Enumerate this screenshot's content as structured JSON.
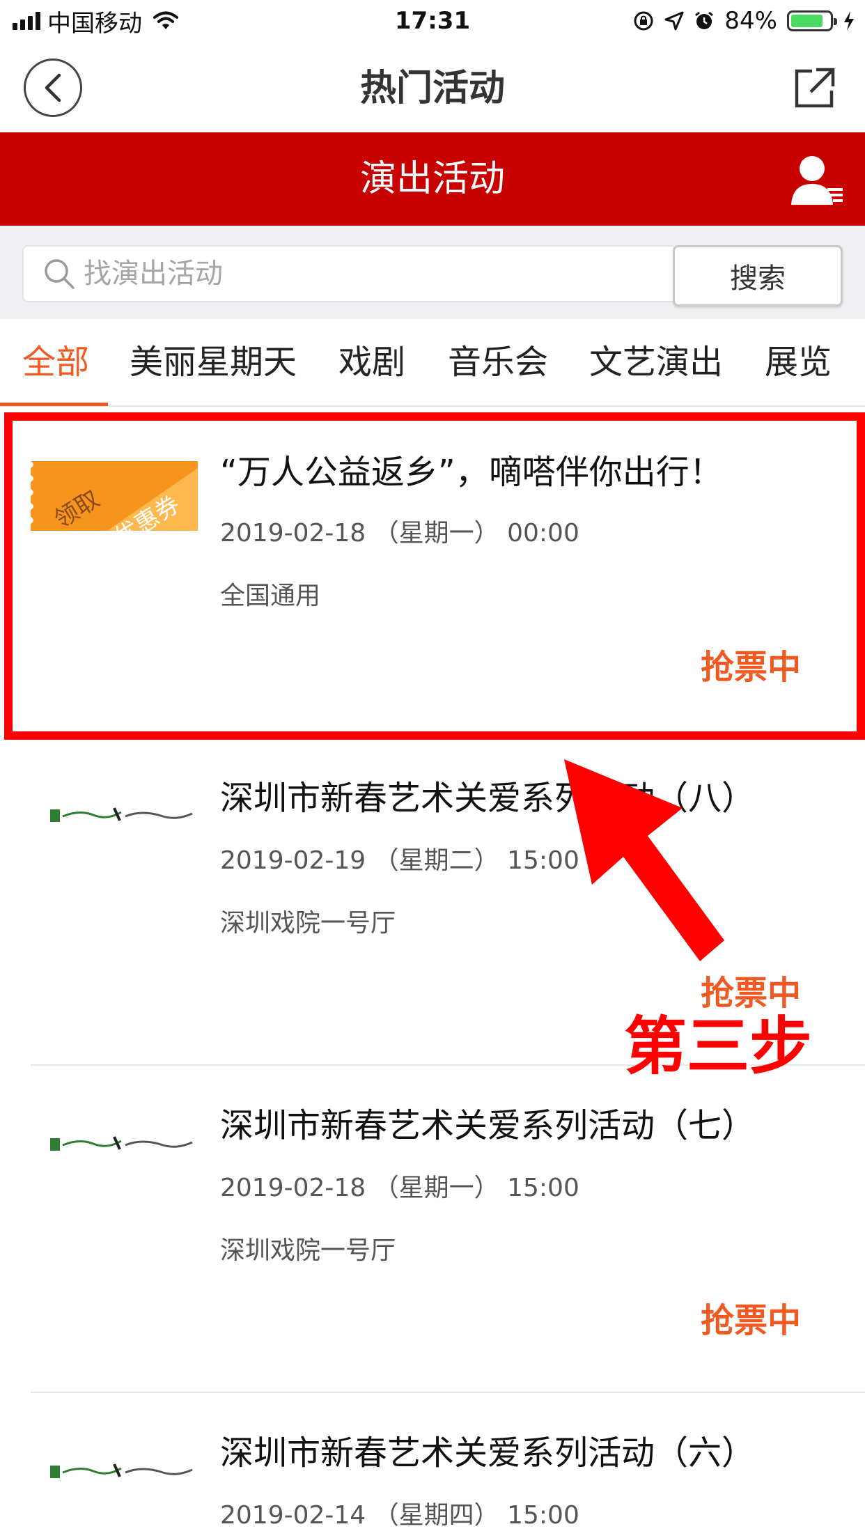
{
  "status_bar": {
    "carrier": "中国移动",
    "time": "17:31",
    "battery": "84%",
    "battery_level": 0.84
  },
  "nav": {
    "title": "热门活动",
    "back_icon": "chevron-left-icon",
    "share_icon": "share-icon"
  },
  "header": {
    "title": "演出活动",
    "user_icon": "user-icon"
  },
  "search": {
    "placeholder": "找演出活动",
    "button_label": "搜索"
  },
  "tabs": [
    {
      "label": "全部",
      "active": true
    },
    {
      "label": "美丽星期天",
      "active": false
    },
    {
      "label": "戏剧",
      "active": false
    },
    {
      "label": "音乐会",
      "active": false
    },
    {
      "label": "文艺演出",
      "active": false
    },
    {
      "label": "展览",
      "active": false
    }
  ],
  "events": [
    {
      "title": "“万人公益返乡”，嘀嗒伴你出行！",
      "date": "2019-02-18 （星期一） 00:00",
      "venue": "全国通用",
      "status": "抢票中",
      "thumb_text": [
        "领取",
        "优惠券"
      ]
    },
    {
      "title": "深圳市新春艺术关爱系列活动（八）",
      "date": "2019-02-19 （星期二） 15:00",
      "venue": "深圳戏院一号厅",
      "status": "抢票中"
    },
    {
      "title": "深圳市新春艺术关爱系列活动（七）",
      "date": "2019-02-18 （星期一） 15:00",
      "venue": "深圳戏院一号厅",
      "status": "抢票中"
    },
    {
      "title": "深圳市新春艺术关爱系列活动（六）",
      "date": "2019-02-14 （星期四） 15:00",
      "venue": "",
      "status": ""
    }
  ],
  "annotation": {
    "step_label": "第三步"
  },
  "colors": {
    "brand_red": "#c70000",
    "accent_orange": "#f05a22",
    "annotation_red": "#ff0000"
  }
}
